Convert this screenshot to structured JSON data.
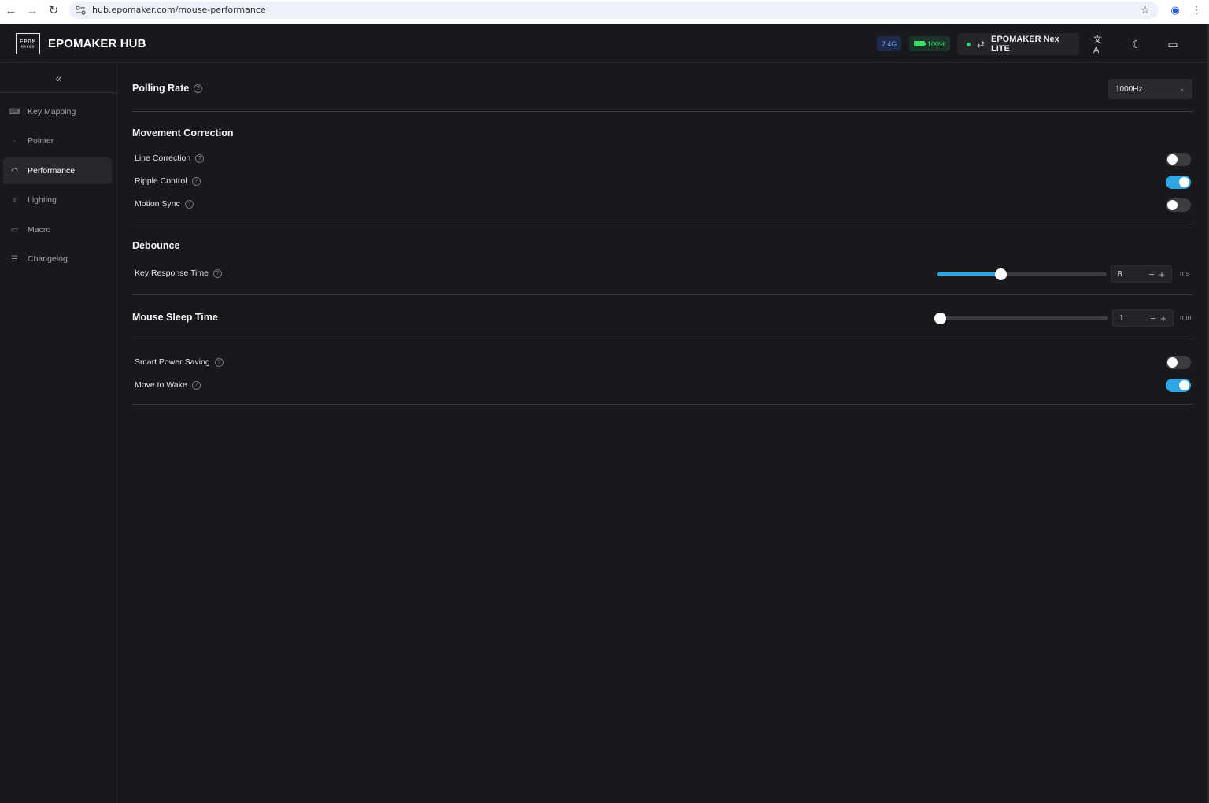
{
  "browser": {
    "url": "hub.epomaker.com/mouse-performance",
    "back_icon": "←",
    "forward_icon": "→",
    "reload_icon": "↻",
    "star_icon": "☆",
    "profile_icon": "◉",
    "menu_icon": "⋮"
  },
  "header": {
    "logo_line1": "EPOM",
    "logo_line2": "MAKER",
    "brand": "EPOMAKER HUB",
    "connection": "2.4G",
    "battery": "100%",
    "device": "EPOMAKER Nex LITE",
    "translate_icon": "文A",
    "theme_icon": "☾",
    "feedback_icon": "▭"
  },
  "sidebar": {
    "collapse_icon": "«",
    "items": [
      {
        "label": "Key Mapping",
        "icon": "⌨"
      },
      {
        "label": "Pointer",
        "icon": "·"
      },
      {
        "label": "Performance",
        "icon": "◠"
      },
      {
        "label": "Lighting",
        "icon": "♀"
      },
      {
        "label": "Macro",
        "icon": "▭"
      },
      {
        "label": "Changelog",
        "icon": "☰"
      }
    ]
  },
  "main": {
    "polling_rate": {
      "title": "Polling Rate",
      "value": "1000Hz",
      "chevron": "⌄"
    },
    "movement": {
      "title": "Movement Correction",
      "rows": [
        {
          "label": "Line Correction",
          "enabled": false
        },
        {
          "label": "Ripple Control",
          "enabled": true
        },
        {
          "label": "Motion Sync",
          "enabled": false
        }
      ]
    },
    "debounce": {
      "title": "Debounce",
      "row_label": "Key Response Time",
      "value": "8",
      "unit": "ms",
      "slider_fraction": 0.37
    },
    "sleep": {
      "title": "Mouse Sleep Time",
      "value": "1",
      "unit": "min",
      "slider_fraction": 0.0
    },
    "power": {
      "rows": [
        {
          "label": "Smart Power Saving",
          "enabled": false
        },
        {
          "label": "Move to Wake",
          "enabled": true
        }
      ]
    },
    "help_glyph": "?",
    "minus_glyph": "−",
    "plus_glyph": "+"
  },
  "colors": {
    "accent": "#2fa6e4",
    "background": "#18191c"
  }
}
